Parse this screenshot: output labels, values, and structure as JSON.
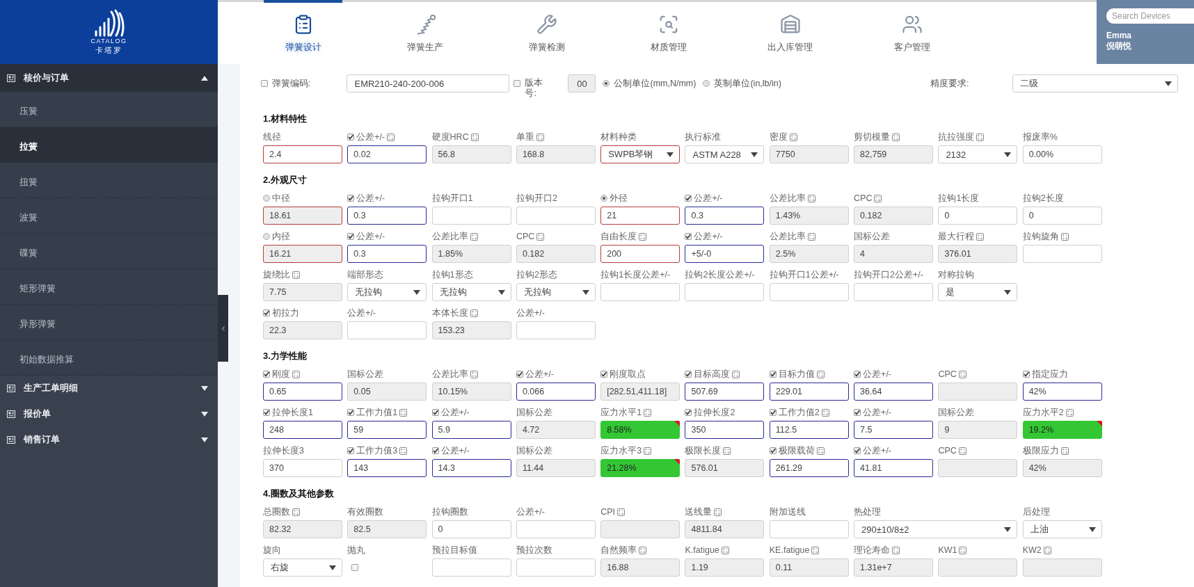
{
  "logo": {
    "brand": "CATALOG",
    "subtitle": "卡塔罗"
  },
  "nav": [
    {
      "label": "弹簧设计",
      "selected": true
    },
    {
      "label": "弹簧生产",
      "selected": false
    },
    {
      "label": "弹簧检测",
      "selected": false
    },
    {
      "label": "材质管理",
      "selected": false
    },
    {
      "label": "出入库管理",
      "selected": false
    },
    {
      "label": "客户管理",
      "selected": false
    }
  ],
  "search": {
    "placeholder": "Search Devices"
  },
  "user": {
    "name": "Emma",
    "full_name": "倪萌悦"
  },
  "sidebar": {
    "groups": [
      {
        "label": "核价与订单",
        "expanded": true,
        "children": [
          {
            "label": "压簧",
            "selected": false
          },
          {
            "label": "拉簧",
            "selected": true
          },
          {
            "label": "扭簧",
            "selected": false
          },
          {
            "label": "波簧",
            "selected": false
          },
          {
            "label": "碟簧",
            "selected": false
          },
          {
            "label": "矩形弹簧",
            "selected": false
          },
          {
            "label": "异形弹簧",
            "selected": false
          },
          {
            "label": "初始数据推算",
            "selected": false
          }
        ]
      },
      {
        "label": "生产工单明细",
        "expanded": false
      },
      {
        "label": "报价单",
        "expanded": false
      },
      {
        "label": "销售订单",
        "expanded": false
      }
    ]
  },
  "top_form": {
    "code": {
      "label": "弹簧编码:",
      "checked": false,
      "value": "EMR210-240-200-006"
    },
    "version": {
      "label": "版本号:",
      "checked": false,
      "value": "00"
    },
    "units": [
      {
        "label": "公制单位(mm,N/mm)",
        "selected": true
      },
      {
        "label": "英制单位(in,lb/in)",
        "selected": false
      }
    ],
    "precision": {
      "label": "精度要求:",
      "value": "二级"
    }
  },
  "sections": [
    {
      "title": "1.材料特性",
      "rows": [
        [
          {
            "label": "线径",
            "kind": "input",
            "invalid": true,
            "value": "2.4"
          },
          {
            "label": "公差+/-",
            "checked": true,
            "calc": true,
            "kind": "input",
            "active": true,
            "value": "0.02"
          },
          {
            "label": "硬度HRC",
            "calc": true,
            "kind": "readonly",
            "value": "56.8"
          },
          {
            "label": "单重",
            "calc": true,
            "kind": "readonly",
            "value": "168.8"
          },
          {
            "label": "材料种类",
            "kind": "select",
            "invalid": true,
            "value": "SWPB琴钢"
          },
          {
            "label": "执行标准",
            "kind": "select",
            "value": "ASTM A228"
          },
          {
            "label": "密度",
            "calc": true,
            "kind": "readonly",
            "value": "7750"
          },
          {
            "label": "剪切模量",
            "calc": true,
            "kind": "readonly",
            "value": "82,759"
          },
          {
            "label": "抗拉强度",
            "calc": true,
            "kind": "select",
            "value": "2132"
          },
          {
            "label": "报废率%",
            "kind": "input",
            "value": "0.00%"
          }
        ]
      ]
    },
    {
      "title": "2.外观尺寸",
      "rows": [
        [
          {
            "label": "中径",
            "selected": false,
            "kind": "readonly",
            "invalid": true,
            "value": "18.61"
          },
          {
            "label": "公差+/-",
            "checked": true,
            "kind": "input",
            "active": true,
            "value": "0.3"
          },
          {
            "label": "拉钩开口1",
            "kind": "input"
          },
          {
            "label": "拉钩开口2",
            "kind": "input"
          },
          {
            "label": "外径",
            "selected": true,
            "kind": "input",
            "invalid": true,
            "value": "21"
          },
          {
            "label": "公差+/-",
            "checked": true,
            "kind": "input",
            "active": true,
            "value": "0.3"
          },
          {
            "label": "公差比率",
            "calc": true,
            "kind": "readonly",
            "value": "1.43%"
          },
          {
            "label": "CPC",
            "calc": true,
            "kind": "readonly",
            "value": "0.182"
          },
          {
            "label": "拉钩1长度",
            "kind": "input",
            "value": "0"
          },
          {
            "label": "拉钩2长度",
            "kind": "input",
            "value": "0"
          }
        ],
        [
          {
            "label": "内径",
            "selected": false,
            "kind": "readonly",
            "invalid": true,
            "value": "16.21"
          },
          {
            "label": "公差+/-",
            "checked": true,
            "kind": "input",
            "active": true,
            "value": "0.3"
          },
          {
            "label": "公差比率",
            "calc": true,
            "kind": "readonly",
            "value": "1.85%"
          },
          {
            "label": "CPC",
            "calc": true,
            "kind": "readonly",
            "value": "0.182"
          },
          {
            "label": "自由长度",
            "calc": true,
            "kind": "input",
            "invalid": true,
            "value": "200"
          },
          {
            "label": "公差+/-",
            "checked": true,
            "kind": "input",
            "active": true,
            "value": "+5/-0"
          },
          {
            "label": "公差比率",
            "calc": true,
            "kind": "readonly",
            "value": "2.5%"
          },
          {
            "label": "国标公差",
            "kind": "readonly",
            "value": "4"
          },
          {
            "label": "最大行程",
            "calc": true,
            "kind": "readonly",
            "value": "376.01"
          },
          {
            "label": "拉钩旋角",
            "calc": true,
            "kind": "input"
          }
        ],
        [
          {
            "label": "旋绕比",
            "calc": true,
            "kind": "readonly",
            "value": "7.75"
          },
          {
            "label": "端部形态",
            "kind": "select",
            "value": "无拉钩"
          },
          {
            "label": "拉钩1形态",
            "kind": "select",
            "value": "无拉钩"
          },
          {
            "label": "拉钩2形态",
            "kind": "select",
            "value": "无拉钩"
          },
          {
            "label": "拉钩1长度公差+/-",
            "kind": "input"
          },
          {
            "label": "拉钩2长度公差+/-",
            "kind": "input"
          },
          {
            "label": "拉钩开口1公差+/-",
            "kind": "input"
          },
          {
            "label": "拉钩开口2公差+/-",
            "kind": "input"
          },
          {
            "label": "对称拉钩",
            "kind": "select",
            "value": "是"
          }
        ],
        [
          {
            "label": "初拉力",
            "checked": true,
            "kind": "readonly",
            "value": "22.3"
          },
          {
            "label": "公差+/-",
            "kind": "input"
          },
          {
            "label": "本体长度",
            "calc": true,
            "kind": "readonly",
            "value": "153.23"
          },
          {
            "label": "公差+/-",
            "kind": "input"
          }
        ]
      ]
    },
    {
      "title": "3.力学性能",
      "rows": [
        [
          {
            "label": "刚度",
            "checked": true,
            "calc": true,
            "kind": "input",
            "active": true,
            "value": "0.65"
          },
          {
            "label": "国标公差",
            "kind": "readonly",
            "value": "0.05"
          },
          {
            "label": "公差比率",
            "calc": true,
            "kind": "readonly",
            "value": "10.15%"
          },
          {
            "label": "公差+/-",
            "checked": true,
            "kind": "input",
            "active": true,
            "value": "0.066"
          },
          {
            "label": "刚度取点",
            "checked": true,
            "kind": "readonly",
            "value": "[282.51,411.18]"
          },
          {
            "label": "目标高度",
            "checked": true,
            "calc": true,
            "kind": "input",
            "active": true,
            "value": "507.69"
          },
          {
            "label": "目标力值",
            "checked": true,
            "calc": true,
            "kind": "input",
            "active": true,
            "value": "229.01"
          },
          {
            "label": "公差+/-",
            "checked": true,
            "kind": "input",
            "active": true,
            "value": "36.64"
          },
          {
            "label": "CPC",
            "calc": true,
            "kind": "readonly"
          },
          {
            "label": "指定应力",
            "checked": true,
            "kind": "input",
            "active": true,
            "value": "42%"
          }
        ],
        [
          {
            "label": "拉伸长度1",
            "checked": true,
            "kind": "input",
            "active": true,
            "value": "248"
          },
          {
            "label": "工作力值1",
            "checked": true,
            "calc": true,
            "kind": "input",
            "active": true,
            "value": "59"
          },
          {
            "label": "公差+/-",
            "checked": true,
            "kind": "input",
            "active": true,
            "value": "5.9"
          },
          {
            "label": "国标公差",
            "kind": "readonly",
            "value": "4.72"
          },
          {
            "label": "应力水平1",
            "calc": true,
            "kind": "readonly",
            "passed": true,
            "value": "8.58%"
          },
          {
            "label": "拉伸长度2",
            "checked": true,
            "kind": "input",
            "active": true,
            "value": "350"
          },
          {
            "label": "工作力值2",
            "checked": true,
            "calc": true,
            "kind": "input",
            "active": true,
            "value": "112.5"
          },
          {
            "label": "公差+/-",
            "checked": true,
            "kind": "input",
            "active": true,
            "value": "7.5"
          },
          {
            "label": "国标公差",
            "kind": "readonly",
            "value": "9"
          },
          {
            "label": "应力水平2",
            "calc": true,
            "kind": "readonly",
            "passed": true,
            "value": "19.2%"
          }
        ],
        [
          {
            "label": "拉伸长度3",
            "kind": "input",
            "value": "370"
          },
          {
            "label": "工作力值3",
            "checked": true,
            "calc": true,
            "kind": "input",
            "active": true,
            "value": "143"
          },
          {
            "label": "公差+/-",
            "checked": true,
            "kind": "input",
            "active": true,
            "value": "14.3"
          },
          {
            "label": "国标公差",
            "kind": "readonly",
            "value": "11.44"
          },
          {
            "label": "应力水平3",
            "calc": true,
            "kind": "readonly",
            "passed": true,
            "value": "21.28%"
          },
          {
            "label": "极限长度",
            "calc": true,
            "kind": "readonly",
            "value": "576.01"
          },
          {
            "label": "极限载荷",
            "checked": true,
            "calc": true,
            "kind": "input",
            "active": true,
            "value": "261.29"
          },
          {
            "label": "公差+/-",
            "checked": true,
            "kind": "input",
            "active": true,
            "value": "41.81"
          },
          {
            "label": "CPC",
            "calc": true,
            "kind": "readonly"
          },
          {
            "label": "极限应力",
            "calc": true,
            "kind": "readonly",
            "value": "42%"
          }
        ]
      ]
    },
    {
      "title": "4.圈数及其他参数",
      "rows": [
        [
          {
            "label": "总圈数",
            "calc": true,
            "kind": "readonly",
            "value": "82.32"
          },
          {
            "label": "有效圈数",
            "kind": "readonly",
            "value": "82.5"
          },
          {
            "label": "拉钩圈数",
            "kind": "input",
            "value": "0"
          },
          {
            "label": "公差+/-",
            "kind": "input"
          },
          {
            "label": "CPI",
            "calc": true,
            "kind": "readonly"
          },
          {
            "label": "送线量",
            "calc": true,
            "kind": "readonly",
            "value": "4811.84"
          },
          {
            "label": "附加送线",
            "kind": "input"
          },
          {
            "label": "热处理",
            "kind": "select",
            "colspan": 2,
            "value": "290±10/8±2"
          },
          {
            "label": "后处理",
            "kind": "select",
            "value": "上油"
          }
        ],
        [
          {
            "label": "旋向",
            "kind": "select",
            "value": "右旋"
          },
          {
            "label": "抛丸",
            "kind": "checkbox",
            "checked": false
          },
          {
            "label": "预拉目标值",
            "kind": "input"
          },
          {
            "label": "预拉次数",
            "kind": "input"
          },
          {
            "label": "自然频率",
            "calc": true,
            "kind": "readonly",
            "value": "16.88"
          },
          {
            "label": "K.fatigue",
            "calc": true,
            "kind": "readonly",
            "value": "1.19"
          },
          {
            "label": "KE.fatigue",
            "calc": true,
            "kind": "readonly",
            "value": "0.11"
          },
          {
            "label": "理论寿命",
            "calc": true,
            "kind": "readonly",
            "value": "1.31e+7"
          },
          {
            "label": "KW1",
            "calc": true,
            "kind": "readonly"
          },
          {
            "label": "KW2",
            "calc": true,
            "kind": "readonly"
          }
        ]
      ]
    }
  ]
}
